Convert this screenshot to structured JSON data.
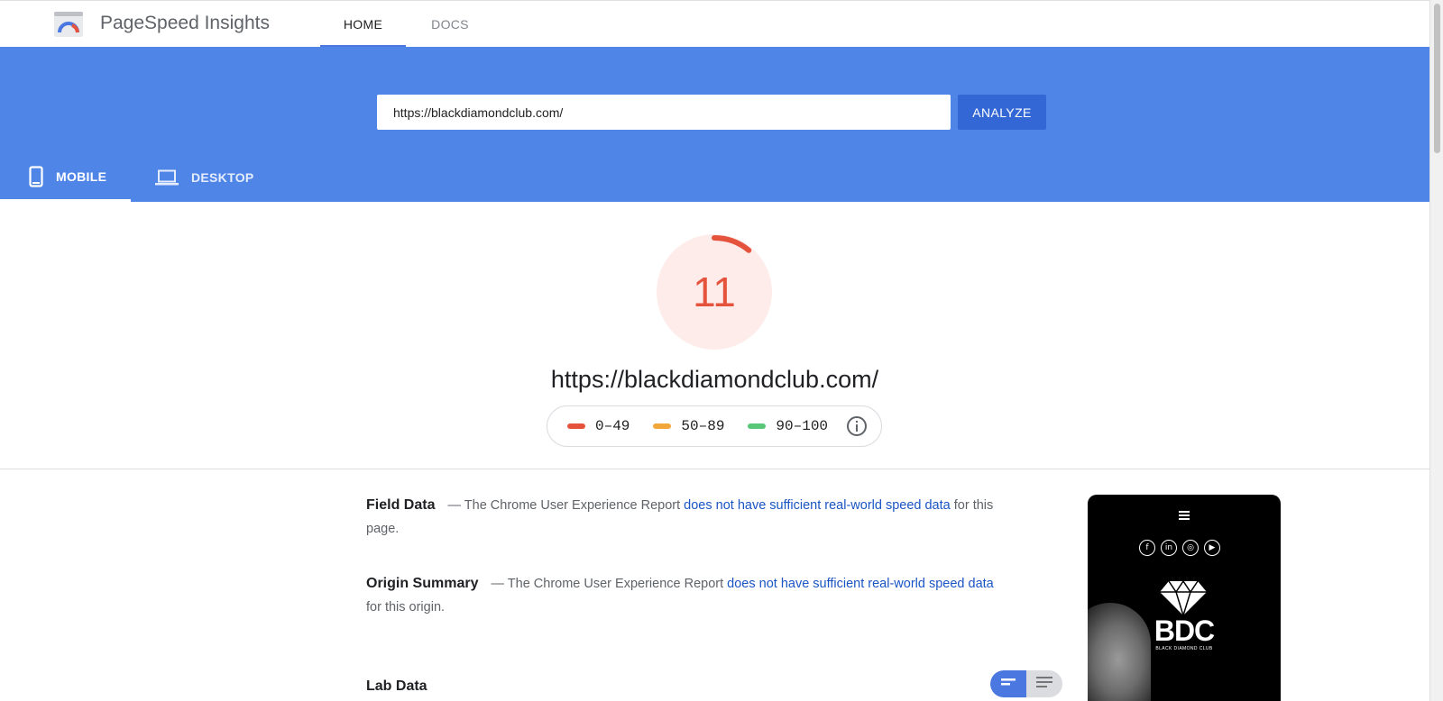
{
  "app": {
    "title": "PageSpeed Insights"
  },
  "nav": {
    "home": "HOME",
    "docs": "DOCS"
  },
  "search": {
    "url_value": "https://blackdiamondclub.com/",
    "analyze_label": "ANALYZE"
  },
  "device_tabs": {
    "mobile": "MOBILE",
    "desktop": "DESKTOP",
    "selected": "MOBILE"
  },
  "score": {
    "value": "11",
    "gauge_fraction": 0.11,
    "color": "#e5533d",
    "url": "https://blackdiamondclub.com/"
  },
  "legend": [
    {
      "range": "0–49",
      "color": "#e5533d"
    },
    {
      "range": "50–89",
      "color": "#f2a73b"
    },
    {
      "range": "90–100",
      "color": "#58c878"
    }
  ],
  "field_data": {
    "heading": "Field Data",
    "prefix": "— The Chrome User Experience Report",
    "link": "does not have sufficient real-world speed data",
    "suffix": "for this page."
  },
  "origin_summary": {
    "heading": "Origin Summary",
    "prefix": "— The Chrome User Experience Report",
    "link": "does not have sufficient real-world speed data",
    "suffix": "for this origin."
  },
  "lab_data": {
    "heading": "Lab Data"
  },
  "preview": {
    "brand": "BDC",
    "subtitle": "BLACK DIAMOND CLUB",
    "social_icons": [
      "f",
      "in",
      "◎",
      "▶"
    ]
  },
  "colors": {
    "accent": "#5085e8",
    "button": "#3467d6",
    "link": "#1a55c4"
  }
}
